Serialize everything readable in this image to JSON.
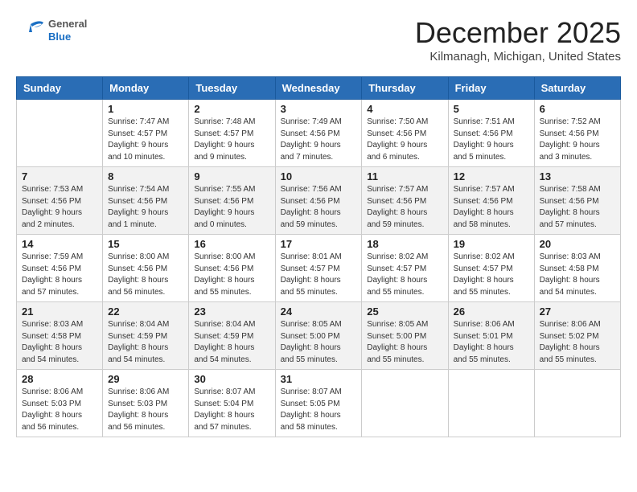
{
  "header": {
    "logo": {
      "general": "General",
      "blue": "Blue"
    },
    "title": "December 2025",
    "location": "Kilmanagh, Michigan, United States"
  },
  "days_of_week": [
    "Sunday",
    "Monday",
    "Tuesday",
    "Wednesday",
    "Thursday",
    "Friday",
    "Saturday"
  ],
  "weeks": [
    [
      {
        "day": "",
        "info": ""
      },
      {
        "day": "1",
        "info": "Sunrise: 7:47 AM\nSunset: 4:57 PM\nDaylight: 9 hours\nand 10 minutes."
      },
      {
        "day": "2",
        "info": "Sunrise: 7:48 AM\nSunset: 4:57 PM\nDaylight: 9 hours\nand 9 minutes."
      },
      {
        "day": "3",
        "info": "Sunrise: 7:49 AM\nSunset: 4:56 PM\nDaylight: 9 hours\nand 7 minutes."
      },
      {
        "day": "4",
        "info": "Sunrise: 7:50 AM\nSunset: 4:56 PM\nDaylight: 9 hours\nand 6 minutes."
      },
      {
        "day": "5",
        "info": "Sunrise: 7:51 AM\nSunset: 4:56 PM\nDaylight: 9 hours\nand 5 minutes."
      },
      {
        "day": "6",
        "info": "Sunrise: 7:52 AM\nSunset: 4:56 PM\nDaylight: 9 hours\nand 3 minutes."
      }
    ],
    [
      {
        "day": "7",
        "info": "Sunrise: 7:53 AM\nSunset: 4:56 PM\nDaylight: 9 hours\nand 2 minutes."
      },
      {
        "day": "8",
        "info": "Sunrise: 7:54 AM\nSunset: 4:56 PM\nDaylight: 9 hours\nand 1 minute."
      },
      {
        "day": "9",
        "info": "Sunrise: 7:55 AM\nSunset: 4:56 PM\nDaylight: 9 hours\nand 0 minutes."
      },
      {
        "day": "10",
        "info": "Sunrise: 7:56 AM\nSunset: 4:56 PM\nDaylight: 8 hours\nand 59 minutes."
      },
      {
        "day": "11",
        "info": "Sunrise: 7:57 AM\nSunset: 4:56 PM\nDaylight: 8 hours\nand 59 minutes."
      },
      {
        "day": "12",
        "info": "Sunrise: 7:57 AM\nSunset: 4:56 PM\nDaylight: 8 hours\nand 58 minutes."
      },
      {
        "day": "13",
        "info": "Sunrise: 7:58 AM\nSunset: 4:56 PM\nDaylight: 8 hours\nand 57 minutes."
      }
    ],
    [
      {
        "day": "14",
        "info": "Sunrise: 7:59 AM\nSunset: 4:56 PM\nDaylight: 8 hours\nand 57 minutes."
      },
      {
        "day": "15",
        "info": "Sunrise: 8:00 AM\nSunset: 4:56 PM\nDaylight: 8 hours\nand 56 minutes."
      },
      {
        "day": "16",
        "info": "Sunrise: 8:00 AM\nSunset: 4:56 PM\nDaylight: 8 hours\nand 55 minutes."
      },
      {
        "day": "17",
        "info": "Sunrise: 8:01 AM\nSunset: 4:57 PM\nDaylight: 8 hours\nand 55 minutes."
      },
      {
        "day": "18",
        "info": "Sunrise: 8:02 AM\nSunset: 4:57 PM\nDaylight: 8 hours\nand 55 minutes."
      },
      {
        "day": "19",
        "info": "Sunrise: 8:02 AM\nSunset: 4:57 PM\nDaylight: 8 hours\nand 55 minutes."
      },
      {
        "day": "20",
        "info": "Sunrise: 8:03 AM\nSunset: 4:58 PM\nDaylight: 8 hours\nand 54 minutes."
      }
    ],
    [
      {
        "day": "21",
        "info": "Sunrise: 8:03 AM\nSunset: 4:58 PM\nDaylight: 8 hours\nand 54 minutes."
      },
      {
        "day": "22",
        "info": "Sunrise: 8:04 AM\nSunset: 4:59 PM\nDaylight: 8 hours\nand 54 minutes."
      },
      {
        "day": "23",
        "info": "Sunrise: 8:04 AM\nSunset: 4:59 PM\nDaylight: 8 hours\nand 54 minutes."
      },
      {
        "day": "24",
        "info": "Sunrise: 8:05 AM\nSunset: 5:00 PM\nDaylight: 8 hours\nand 55 minutes."
      },
      {
        "day": "25",
        "info": "Sunrise: 8:05 AM\nSunset: 5:00 PM\nDaylight: 8 hours\nand 55 minutes."
      },
      {
        "day": "26",
        "info": "Sunrise: 8:06 AM\nSunset: 5:01 PM\nDaylight: 8 hours\nand 55 minutes."
      },
      {
        "day": "27",
        "info": "Sunrise: 8:06 AM\nSunset: 5:02 PM\nDaylight: 8 hours\nand 55 minutes."
      }
    ],
    [
      {
        "day": "28",
        "info": "Sunrise: 8:06 AM\nSunset: 5:03 PM\nDaylight: 8 hours\nand 56 minutes."
      },
      {
        "day": "29",
        "info": "Sunrise: 8:06 AM\nSunset: 5:03 PM\nDaylight: 8 hours\nand 56 minutes."
      },
      {
        "day": "30",
        "info": "Sunrise: 8:07 AM\nSunset: 5:04 PM\nDaylight: 8 hours\nand 57 minutes."
      },
      {
        "day": "31",
        "info": "Sunrise: 8:07 AM\nSunset: 5:05 PM\nDaylight: 8 hours\nand 58 minutes."
      },
      {
        "day": "",
        "info": ""
      },
      {
        "day": "",
        "info": ""
      },
      {
        "day": "",
        "info": ""
      }
    ]
  ]
}
